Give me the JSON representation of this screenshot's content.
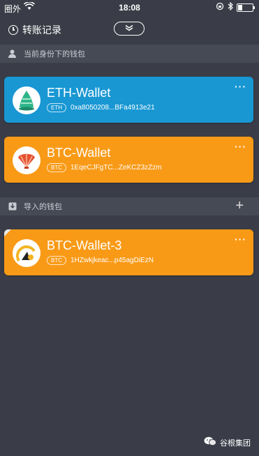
{
  "status_bar": {
    "carrier": "圈外",
    "time": "18:08"
  },
  "header": {
    "title": "转账记录"
  },
  "sections": {
    "current_label": "当前身份下的钱包",
    "imported_label": "导入的钱包"
  },
  "wallets": [
    {
      "name": "ETH-Wallet",
      "tag": "ETH",
      "address": "0xa8050208...BFa4913e21",
      "color": "#1897d3"
    },
    {
      "name": "BTC-Wallet",
      "tag": "BTC",
      "address": "1EqeCJFgTC...ZeKCZ3zZzm",
      "color": "#f99a17"
    }
  ],
  "imported_wallets": [
    {
      "name": "BTC-Wallet-3",
      "tag": "BTC",
      "address": "1HZwkjkeac...p45agDiEzN",
      "color": "#f99a17"
    }
  ],
  "watermark": {
    "text": "谷根集团"
  }
}
